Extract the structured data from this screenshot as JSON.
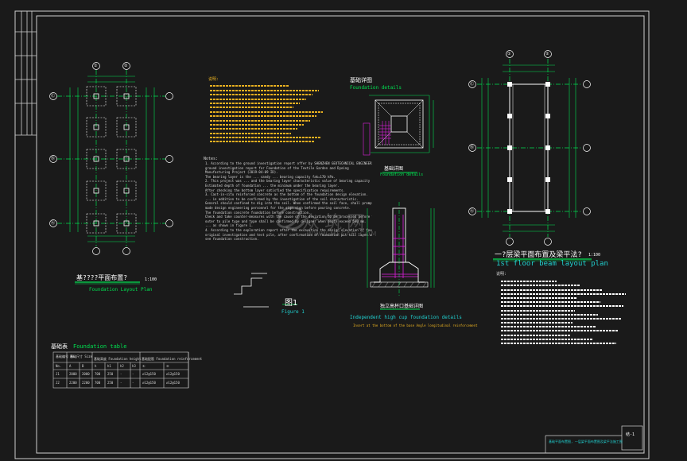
{
  "plan_foundation": {
    "title_cn": "基????平面布置?",
    "scale": "1:100",
    "title_en": "Foundation Layout Plan",
    "axis_cols": [
      "①",
      "②"
    ],
    "axis_rows": [
      "Ⓒ",
      "Ⓑ",
      "Ⓐ"
    ]
  },
  "notes_cn_heading": "说明:",
  "notes_en_heading": "Notes:",
  "notes_en": [
    "1. According to the ground investigation report offer by SHENZHEN GEOTECHNICAL ENGINEERING CO.",
    "   ground investigation report for Foundation of the Textile Garden and Dyeing",
    "   Manufacturing Project (2019-04-09 ID).",
    "   The bearing layer is the ... sandy ... bearing capacity fak=170 kPa.",
    "2. This project was ... and the bearing layer characteristic value of bearing capacity",
    "   Estimated depth of foundation ... the minimum under the bearing layer.",
    "   After checking the bottom layer satisfied the specification requirements.",
    "3. Cast-in-situ reinforced concrete as the bottom of the foundation design elevation.",
    "   ... in addition to be confirmed by the investigation of the soil characteristic.",
    "   General should confined to dig into the soil. When confirmed the soil face, shall promptly notify the designer.",
    "   made design engineering personnel for the sign sign before pouring concrete.",
    "   The foundation concrete foundation before construction.",
    "   Check and take counter-measures with the cause of the deviation to be processed before the bearing layer.",
    "   outer to pile type and type shall be confirmed by designer when depth exceed 500 mm.",
    "   ... as shown in figure 1.",
    "4. According to the exploration report after the excavation the design elevation of foundation pit.",
    "   original investigation and test pile, after confirmation of foundation pit sill layer with the design report.",
    "   see foundation construction."
  ],
  "detail_foundation": {
    "title_cn": "基础详图",
    "title_en": "Foundation details",
    "sub_cn": "基础详图",
    "sub_en": "Foundation details"
  },
  "figure1": {
    "title_cn": "图1",
    "title_en": "Figure 1"
  },
  "detail_cup": {
    "title_cn": "独立高杯口基础详图",
    "title_en": "Independent high cup foundation details",
    "note": "Insert at the bottom of the base Angle longitudinal reinforcement"
  },
  "beam_plan": {
    "title_cn": "一?层梁平面布置及梁平法?",
    "scale": "1:100",
    "title_en": "1st floor beam layout plan",
    "axis_cols": [
      "①",
      "②"
    ],
    "axis_rows": [
      "Ⓒ",
      "Ⓑ",
      "Ⓐ"
    ]
  },
  "beam_notes_heading": "说明:",
  "table": {
    "title_cn": "基础表",
    "title_en": "Foundation table",
    "headers": [
      "基础编号 No.",
      "基础尺寸 Size",
      "",
      "",
      "基础高度 Foundation height",
      "",
      "",
      "基础配筋 Foundation reinforcement",
      ""
    ],
    "subheaders": [
      "No.",
      "A",
      "B",
      "h",
      "h1",
      "h2",
      "h3",
      "①",
      "②"
    ],
    "rows": [
      [
        "J1",
        "2000",
        "2000",
        "700",
        "250",
        "-",
        "-",
        "⌀12@150",
        "⌀12@150"
      ],
      [
        "J2",
        "2200",
        "2200",
        "700",
        "250",
        "-",
        "-",
        "⌀12@150",
        "⌀12@150"
      ]
    ]
  },
  "watermark": {
    "cn": "众筑网",
    "en": "WWW.MFCAD.COM"
  },
  "title_block": {
    "sheet_no": "结-1",
    "drawing_name": "基础平面布置图, 一层梁平面布置图及梁平法施工图"
  },
  "colors": {
    "background": "#1a1a1a",
    "grid_line": "#00e050",
    "column": "#ffffff",
    "dimension": "#d8d8d8",
    "notes_cn": "#e8b020",
    "notes_en": "#d8d8d8",
    "hatch": "#e020e0",
    "title_en": "#20d0d0"
  }
}
